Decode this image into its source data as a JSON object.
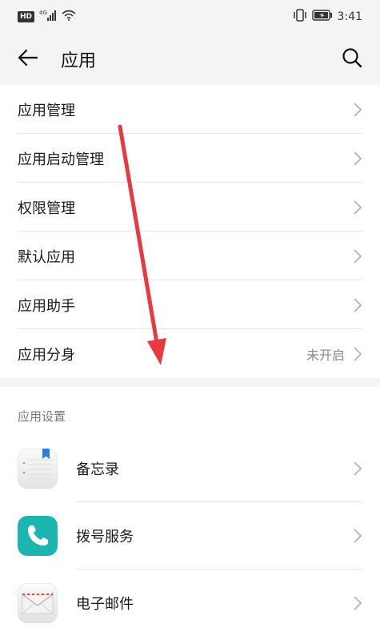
{
  "status_bar": {
    "left_badges": [
      "HD",
      "4G"
    ],
    "time": "3:41"
  },
  "header": {
    "title": "应用"
  },
  "menu": [
    {
      "label": "应用管理",
      "value": ""
    },
    {
      "label": "应用启动管理",
      "value": ""
    },
    {
      "label": "权限管理",
      "value": ""
    },
    {
      "label": "默认应用",
      "value": ""
    },
    {
      "label": "应用助手",
      "value": ""
    },
    {
      "label": "应用分身",
      "value": "未开启"
    }
  ],
  "app_settings": {
    "section_label": "应用设置",
    "items": [
      {
        "label": "备忘录",
        "icon": "notepad-icon"
      },
      {
        "label": "拨号服务",
        "icon": "phone-icon"
      },
      {
        "label": "电子邮件",
        "icon": "email-icon"
      }
    ]
  },
  "colors": {
    "annotation_arrow": "#e8393f",
    "phone_icon_bg": "#1cb5b0",
    "notepad_bookmark": "#2f7fd6"
  }
}
